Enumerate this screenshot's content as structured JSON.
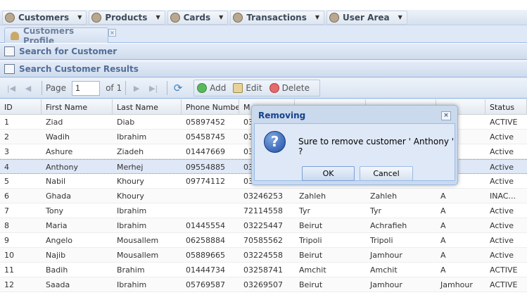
{
  "menu": [
    {
      "label": "Customers",
      "icon": "user-icon"
    },
    {
      "label": "Products",
      "icon": "products-icon"
    },
    {
      "label": "Cards",
      "icon": "cards-icon"
    },
    {
      "label": "Transactions",
      "icon": "transactions-icon"
    },
    {
      "label": "User Area",
      "icon": "user-area-icon"
    }
  ],
  "tab": {
    "label": "Customers Profile",
    "close": "×"
  },
  "panels": {
    "search": "Search for Customer",
    "results": "Search Customer Results"
  },
  "toolbar": {
    "page_label": "Page",
    "page_value": "1",
    "of_label": "of 1",
    "add": "Add",
    "edit": "Edit",
    "delete": "Delete"
  },
  "grid": {
    "columns": [
      "ID",
      "First Name",
      "Last Name",
      "Phone Number",
      "M",
      "",
      "",
      "",
      "Status"
    ],
    "rows": [
      [
        "1",
        "Ziad",
        "Diab",
        "05897452",
        "03",
        "",
        "",
        "",
        "ACTIVE"
      ],
      [
        "2",
        "Wadih",
        "Ibrahim",
        "05458745",
        "03",
        "",
        "",
        "",
        "Active"
      ],
      [
        "3",
        "Ashure",
        "Ziadeh",
        "01447669",
        "03",
        "",
        "",
        "",
        "Active"
      ],
      [
        "4",
        "Anthony",
        "Merhej",
        "09554885",
        "03",
        "",
        "",
        "",
        "Active"
      ],
      [
        "5",
        "Nabil",
        "Khoury",
        "09774112",
        "03",
        "",
        "",
        "",
        "Active"
      ],
      [
        "6",
        "Ghada",
        "Khoury",
        "",
        "03246253",
        "Zahleh",
        "Zahleh",
        "A",
        "INAC..."
      ],
      [
        "7",
        "Tony",
        "Ibrahim",
        "",
        "72114558",
        "Tyr",
        "Tyr",
        "A",
        "Active"
      ],
      [
        "8",
        "Maria",
        "Ibrahim",
        "01445554",
        "03225447",
        "Beirut",
        "Achrafieh",
        "A",
        "Active"
      ],
      [
        "9",
        "Angelo",
        "Mousallem",
        "06258884",
        "70585562",
        "Tripoli",
        "Tripoli",
        "A",
        "Active"
      ],
      [
        "10",
        "Najib",
        "Mousallem",
        "05889665",
        "03224558",
        "Beirut",
        "Jamhour",
        "A",
        "Active"
      ],
      [
        "11",
        "Badih",
        "Brahim",
        "01444734",
        "03258741",
        "Amchit",
        "Amchit",
        "A",
        "ACTIVE"
      ],
      [
        "12",
        "Saada",
        "Ibrahim",
        "05769587",
        "03269507",
        "Beirut",
        "Jamhour",
        "Jamhour",
        "ACTIVE"
      ]
    ],
    "selected_index": 3
  },
  "dialog": {
    "title": "Removing",
    "message": "Sure to remove customer ' Anthony ' ?",
    "ok": "OK",
    "cancel": "Cancel",
    "close": "×",
    "question_glyph": "?"
  }
}
